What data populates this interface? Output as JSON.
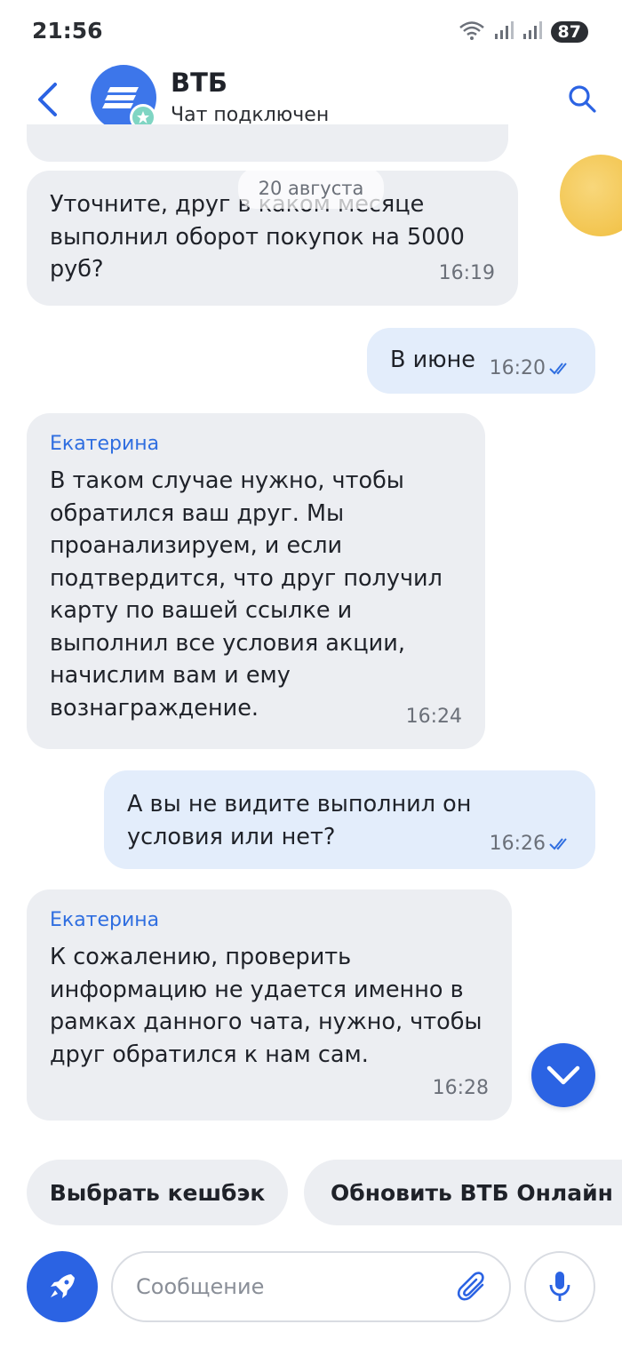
{
  "status_bar": {
    "time": "21:56",
    "battery": "87",
    "network_label": "5"
  },
  "header": {
    "title": "ВТБ",
    "subtitle": "Чат подключен"
  },
  "date_separator": "20 августа",
  "messages": [
    {
      "direction": "in",
      "author": "",
      "text": "Уточните, друг в каком месяце выполнил оборот покупок на 5000 руб?",
      "time": "16:19"
    },
    {
      "direction": "out",
      "text": "В июне",
      "time": "16:20",
      "read": true
    },
    {
      "direction": "in",
      "author": "Екатерина",
      "text": "В таком случае нужно, чтобы обратился ваш друг. Мы проанализируем, и если подтвердится, что друг получил карту по вашей ссылке и выполнил все условия акции, начислим вам и ему вознаграждение.",
      "time": "16:24"
    },
    {
      "direction": "out",
      "text": "А вы не видите выполнил он условия или нет?",
      "time": "16:26",
      "read": true
    },
    {
      "direction": "in",
      "author": "Екатерина",
      "text": "К сожалению, проверить информацию не удается именно в рамках данного чата, нужно, чтобы друг обратился к нам сам.",
      "time": "16:28"
    }
  ],
  "quick_replies": [
    "Выбрать кешбэк",
    "Обновить ВТБ Онлайн"
  ],
  "composer": {
    "placeholder": "Сообщение"
  },
  "colors": {
    "accent": "#2b63e3",
    "incoming_bubble": "#eceef2",
    "outgoing_bubble": "#e3edfb",
    "author_name": "#2f6ee0"
  }
}
